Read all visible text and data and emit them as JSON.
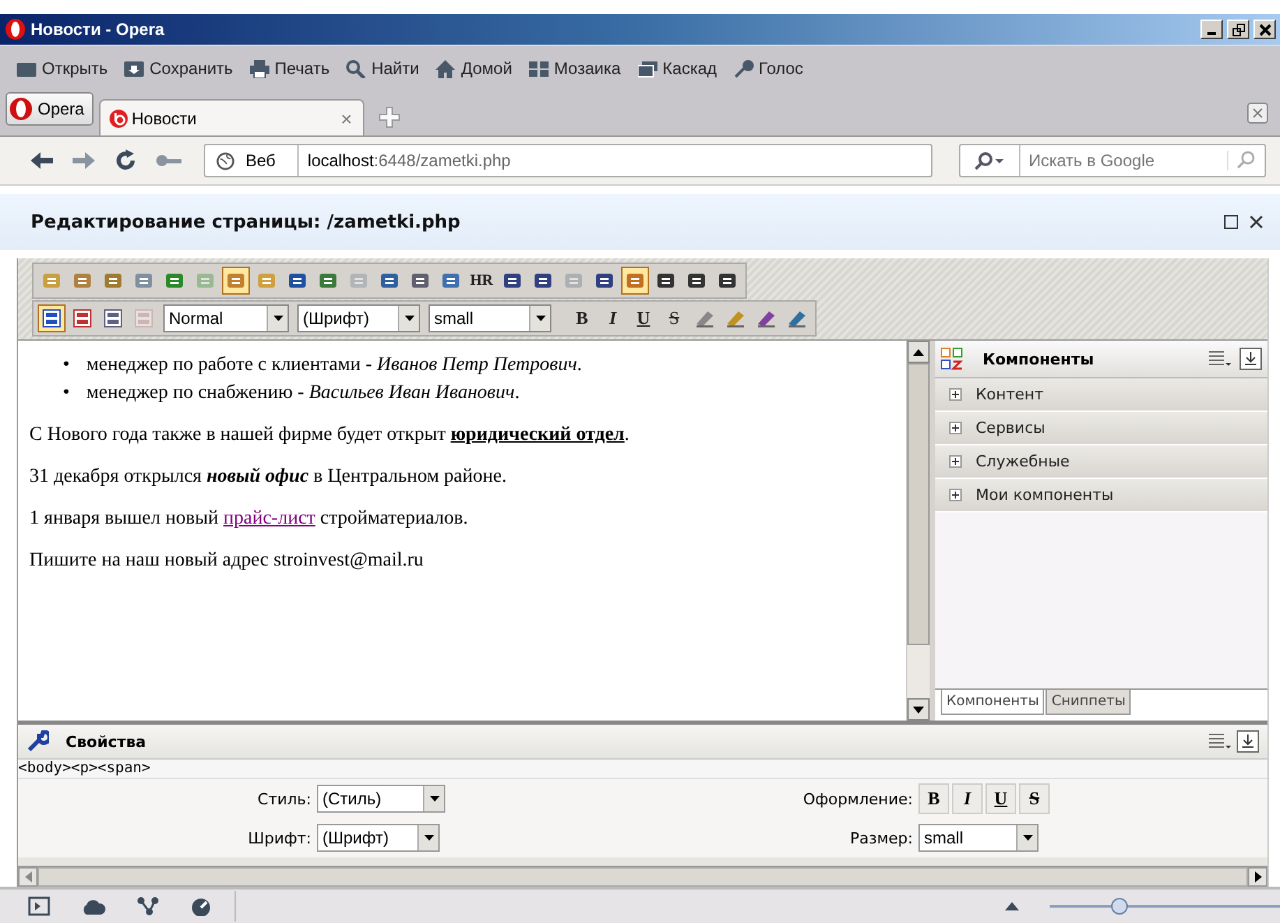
{
  "window": {
    "title": "Новости - Opera"
  },
  "toolbar": [
    {
      "label": "Открыть"
    },
    {
      "label": "Сохранить"
    },
    {
      "label": "Печать"
    },
    {
      "label": "Найти"
    },
    {
      "label": "Домой"
    },
    {
      "label": "Мозаика"
    },
    {
      "label": "Каскад"
    },
    {
      "label": "Голос"
    }
  ],
  "tabs": {
    "menu_label": "Opera",
    "items": [
      {
        "label": "Новости",
        "selected": true,
        "close": "×"
      }
    ]
  },
  "address": {
    "badge": "Веб",
    "url_host": "localhost",
    "url_path": ":6448/zametki.php",
    "search_placeholder": "Искать в Google"
  },
  "page_header": {
    "title": "Редактирование страницы: /zametki.php"
  },
  "editor_toolbar": {
    "row_1": [
      {
        "selected": false,
        "disabled": false
      },
      {
        "selected": false,
        "disabled": false
      },
      {
        "selected": false,
        "disabled": false
      },
      {
        "selected": false,
        "disabled": false
      },
      {
        "selected": false,
        "disabled": false
      },
      {
        "selected": false,
        "disabled": true
      },
      {
        "selected": true,
        "disabled": false
      },
      {
        "selected": false,
        "disabled": false
      },
      {
        "selected": false,
        "disabled": false
      },
      {
        "selected": false,
        "disabled": false
      },
      {
        "selected": false,
        "disabled": true
      },
      {
        "selected": false,
        "disabled": false
      },
      {
        "selected": false,
        "disabled": false
      },
      {
        "selected": false,
        "disabled": false
      },
      {
        "label": "HR",
        "selected": false,
        "disabled": false
      },
      {
        "selected": false,
        "disabled": false
      },
      {
        "selected": false,
        "disabled": false
      },
      {
        "selected": false,
        "disabled": true
      },
      {
        "selected": false,
        "disabled": false
      },
      {
        "selected": true,
        "disabled": false
      },
      {
        "selected": false,
        "disabled": false
      },
      {
        "selected": false,
        "disabled": false
      },
      {
        "selected": false,
        "disabled": false
      }
    ],
    "row_2_start": [
      {
        "selected": true,
        "disabled": false
      },
      {
        "selected": false,
        "disabled": false
      },
      {
        "selected": false,
        "disabled": false
      },
      {
        "selected": false,
        "disabled": true
      }
    ],
    "dropdowns": [
      "Normal",
      "(Шрифт)",
      "small"
    ],
    "row_2_end": [
      {
        "label": "B",
        "selected": false,
        "disabled": false
      },
      {
        "label": "I",
        "selected": false,
        "disabled": false
      },
      {
        "label": "U",
        "selected": false,
        "disabled": false
      },
      {
        "label": "S",
        "selected": false,
        "disabled": false
      },
      {
        "selected": false,
        "disabled": false
      },
      {
        "selected": false,
        "disabled": false
      },
      {
        "selected": false,
        "disabled": false
      },
      {
        "selected": false,
        "disabled": false
      }
    ]
  },
  "content": {
    "list_items": [
      {
        "marker": "•",
        "text": "менеджер по работе с клиентами - *Иванов Петр Петрович*."
      },
      {
        "marker": "•",
        "text": "менеджер по снабжению - *Васильев Иван Иванович*."
      }
    ],
    "paragraphs": [
      [
        {
          "kind": "plain",
          "text": "С Нового года также в нашей фирме будет открыт "
        },
        {
          "kind": "bold-underline",
          "text": "юридический отдел"
        },
        {
          "kind": "plain",
          "text": "."
        }
      ],
      [
        {
          "kind": "plain",
          "text": "31 декабря открылся "
        },
        {
          "kind": "bold-italic",
          "text": "новый офис"
        },
        {
          "kind": "plain",
          "text": " в Центральном районе."
        }
      ],
      [
        {
          "kind": "plain",
          "text": "1 января вышел новый "
        },
        {
          "kind": "link",
          "text": "прайс-лист"
        },
        {
          "kind": "plain",
          "text": " стройматериалов."
        }
      ],
      [
        {
          "kind": "plain",
          "text": "Пишите на наш новый адрес stroinvest@mail.ru"
        }
      ]
    ]
  },
  "components_panel": {
    "title": "Компоненты",
    "items": [
      {
        "label": "Контент",
        "expanded": false
      },
      {
        "label": "Сервисы",
        "expanded": false
      },
      {
        "label": "Служебные",
        "expanded": false
      },
      {
        "label": "Мои компоненты",
        "expanded": false
      }
    ],
    "tabs": [
      {
        "label": "Компоненты",
        "selected": true
      },
      {
        "label": "Сниппеты",
        "selected": false
      }
    ]
  },
  "properties": {
    "title": "Свойства",
    "path": "<body><p><span>",
    "style_label": "Стиль:",
    "style_value": "(Стиль)",
    "font_label": "Шрифт:",
    "font_value": "(Шрифт)",
    "format_label": "Оформление:",
    "format_buttons": [
      "B",
      "I",
      "U",
      "S"
    ],
    "size_label": "Размер:",
    "size_value": "small"
  },
  "status_bar": {
    "zoom_slider": {
      "level": 0.3
    }
  }
}
